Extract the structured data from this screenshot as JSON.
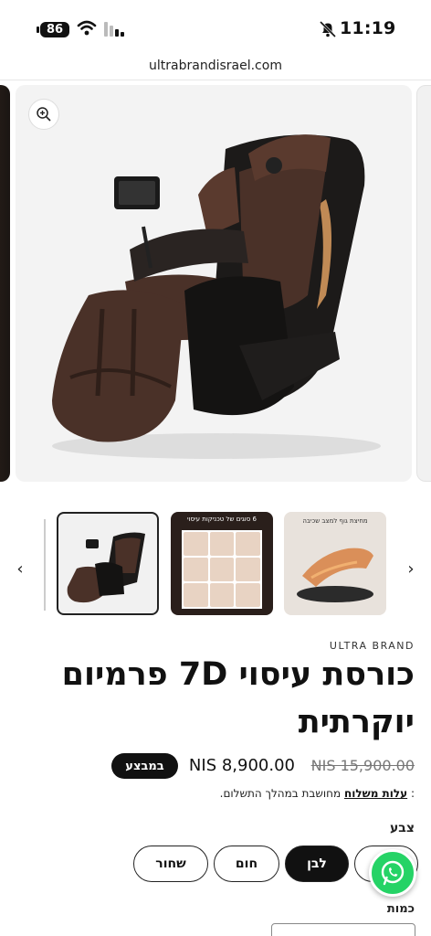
{
  "status_bar": {
    "battery": "86",
    "time": "11:19"
  },
  "browser": {
    "url": "ultrabrandisrael.com"
  },
  "gallery": {
    "thumbnails": [
      {
        "caption": ""
      },
      {
        "caption": "6 סוגים של טכניקות עיסוי"
      },
      {
        "caption": "מחיצת גוף למצב שכיבה"
      }
    ]
  },
  "product": {
    "vendor": "ULTRA BRAND",
    "title": "כורסת עיסוי 7D פרמיום יוקרתית",
    "regular_price": "NIS 15,900.00",
    "sale_price": "NIS 8,900.00",
    "sale_badge": "במבצע",
    "shipping_prefix": ":",
    "shipping_link": "עלות משלוח",
    "shipping_suffix": "מחושבת במהלך התשלום."
  },
  "options": {
    "color_label": "צבע",
    "colors": [
      "",
      "לבן",
      "חום",
      "שחור"
    ],
    "selected_color": "לבן",
    "quantity_label": "כמות"
  },
  "colors": {
    "accent": "#111111",
    "whatsapp": "#25D366",
    "chair_leather": "#4a3128",
    "chair_trim": "#c08a55"
  }
}
